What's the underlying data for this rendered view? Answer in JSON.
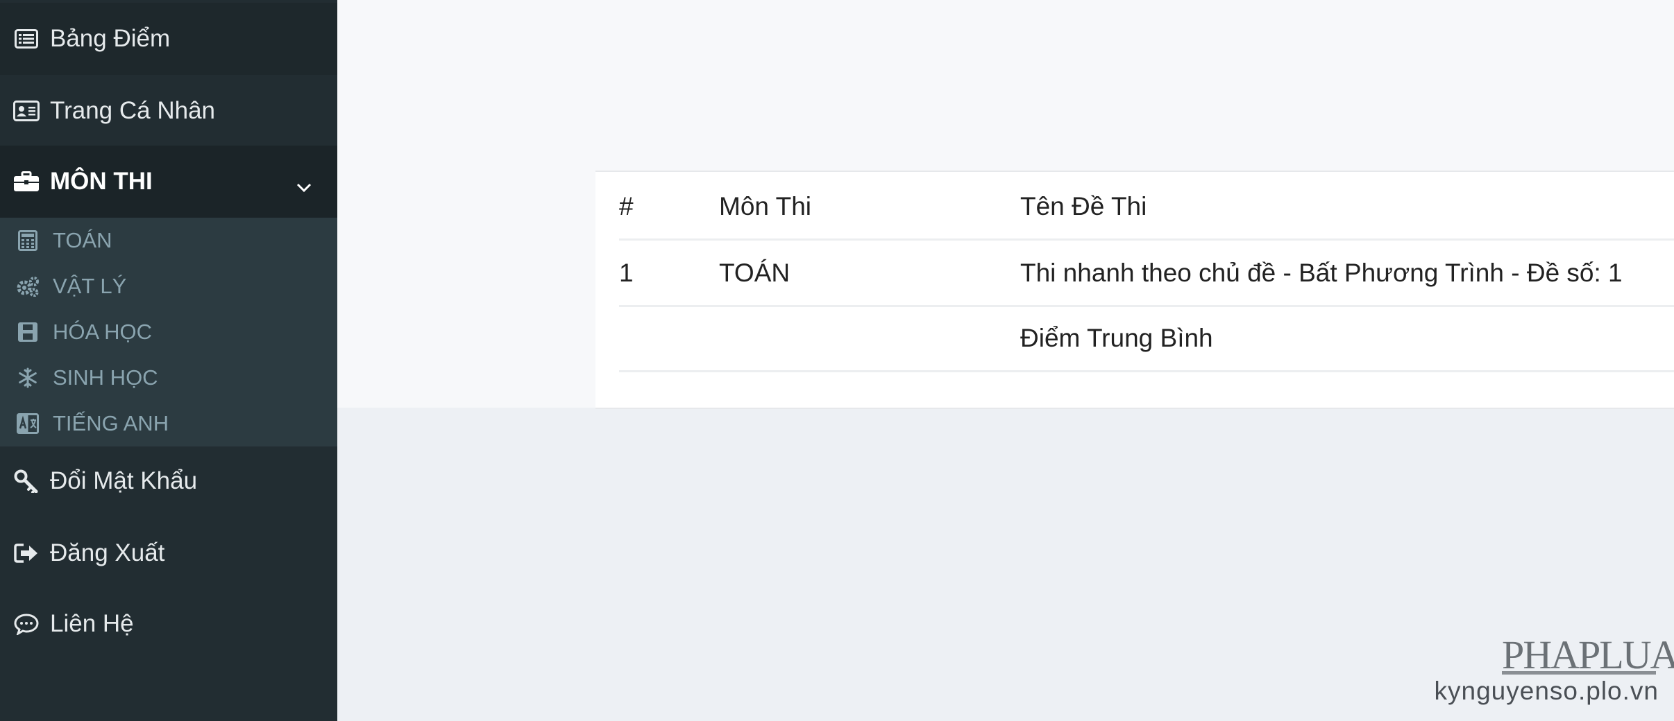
{
  "sidebar": {
    "items": [
      {
        "label": "Bảng Điểm",
        "icon": "list-alt-icon"
      },
      {
        "label": "Trang Cá Nhân",
        "icon": "id-card-icon"
      },
      {
        "label": "MÔN THI",
        "icon": "briefcase-icon",
        "expanded": true
      },
      {
        "label": "Đổi Mật Khẩu",
        "icon": "key-icon"
      },
      {
        "label": "Đăng Xuất",
        "icon": "sign-out-icon"
      },
      {
        "label": "Liên Hệ",
        "icon": "comment-icon"
      }
    ],
    "submenu": [
      {
        "label": "TOÁN",
        "icon": "calculator-icon"
      },
      {
        "label": "VẬT LÝ",
        "icon": "cogs-icon"
      },
      {
        "label": "HÓA HỌC",
        "icon": "save-icon"
      },
      {
        "label": "SINH HỌC",
        "icon": "snowflake-icon"
      },
      {
        "label": "TIẾNG ANH",
        "icon": "language-icon"
      }
    ]
  },
  "table": {
    "headers": [
      "#",
      "Môn Thi",
      "Tên Đề Thi"
    ],
    "rows": [
      {
        "num": "1",
        "subject": "TOÁN",
        "title": "Thi nhanh theo chủ đề - Bất Phương Trình - Đề số: 1"
      }
    ],
    "footer_label": "Điểm Trung Bình"
  },
  "watermark": {
    "logo": "PHAPLUAT",
    "url": "kynguyenso.plo.vn"
  },
  "colors": {
    "sidebar_bg": "#222d32",
    "submenu_bg": "#2c3b41",
    "main_bg": "#f7f8fa",
    "lower_bg": "#edf0f4"
  }
}
